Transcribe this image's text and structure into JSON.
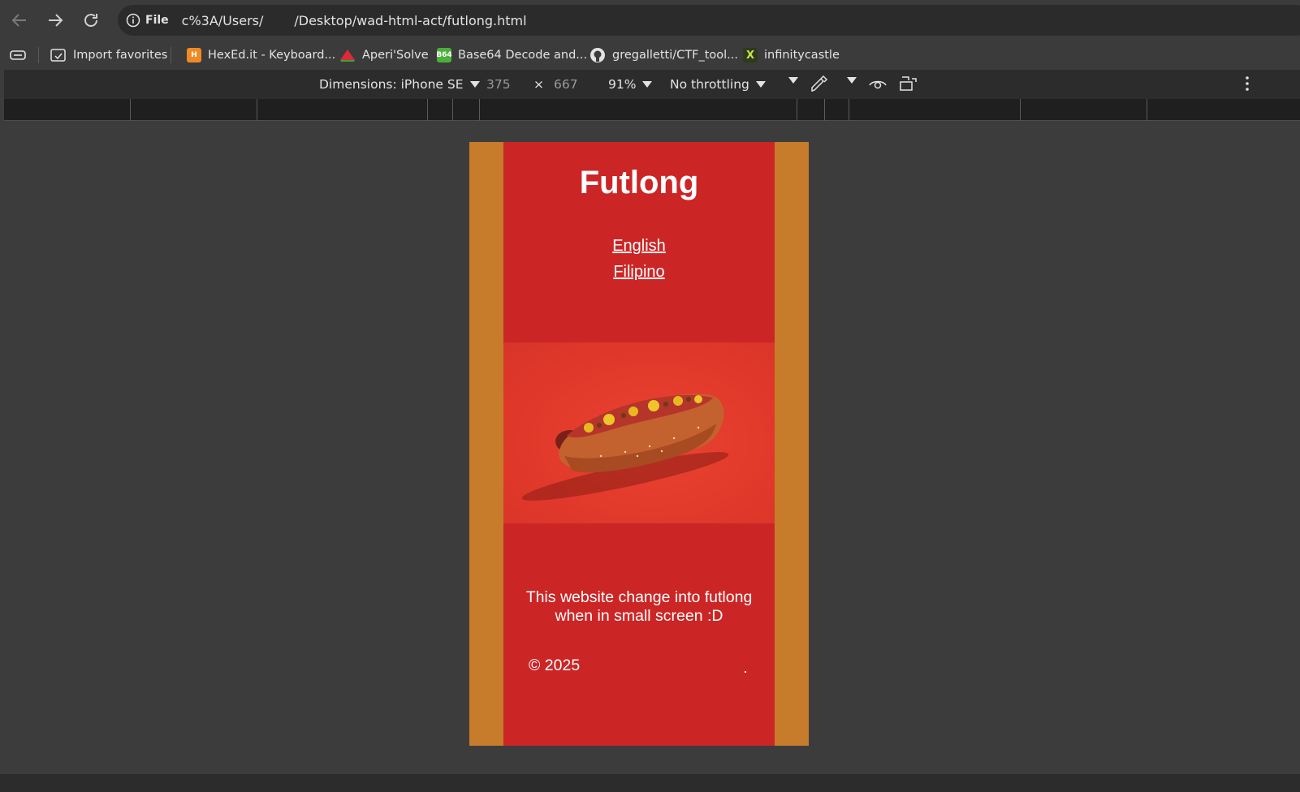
{
  "browser": {
    "url_scheme": "File",
    "url_part1": "c%3A/Users/",
    "url_part2": "/Desktop/wad-html-act/futlong.html"
  },
  "bookmarks": [
    {
      "label": "Import favorites",
      "icon": "import-icon"
    },
    {
      "label": "HexEd.it - Keyboard...",
      "icon": "hexedit-icon"
    },
    {
      "label": "Aperi'Solve",
      "icon": "watermelon-icon"
    },
    {
      "label": "Base64 Decode and...",
      "icon": "b64-icon",
      "icon_text": "B64"
    },
    {
      "label": "gregalletti/CTF_tool...",
      "icon": "github-icon"
    },
    {
      "label": "infinitycastle",
      "icon": "x-icon"
    }
  ],
  "devtools": {
    "dimensions_label": "Dimensions: iPhone SE",
    "width": "375",
    "times": "×",
    "height": "667",
    "zoom": "91%",
    "throttling": "No throttling"
  },
  "page": {
    "title": "Futlong",
    "links": [
      "English",
      "Filipino"
    ],
    "description": "This website change into futlong when in small screen :D",
    "footer": "© 2025",
    "colors": {
      "background": "#cc2525",
      "side_bars": "#c67c2a",
      "text": "#ffffff"
    }
  }
}
